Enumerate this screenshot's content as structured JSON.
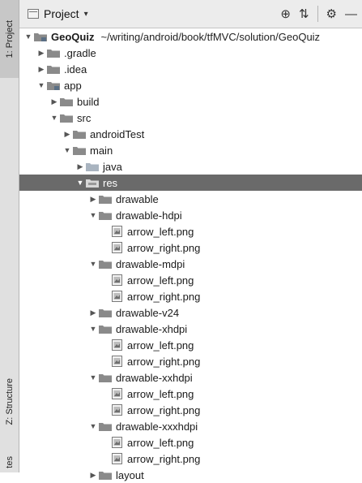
{
  "toolbar": {
    "title": "Project",
    "caret": "▾",
    "target": "⊕",
    "collapse": "⇅",
    "gear": "⚙",
    "minimize": "—"
  },
  "side_tabs": {
    "project": "1: Project",
    "structure": "Z: Structure",
    "favorites": "tes"
  },
  "tree": [
    {
      "label": "GeoQuiz",
      "path": "~/writing/android/book/tfMVC/solution/GeoQuiz",
      "depth": 0,
      "arrow": "▼",
      "icon": "module-folder-icon"
    },
    {
      "label": ".gradle",
      "depth": 1,
      "arrow": "▶",
      "icon": "folder-icon"
    },
    {
      "label": ".idea",
      "depth": 1,
      "arrow": "▶",
      "icon": "folder-icon"
    },
    {
      "label": "app",
      "depth": 1,
      "arrow": "▼",
      "icon": "module-folder-icon"
    },
    {
      "label": "build",
      "depth": 2,
      "arrow": "▶",
      "icon": "folder-icon"
    },
    {
      "label": "src",
      "depth": 2,
      "arrow": "▼",
      "icon": "folder-icon"
    },
    {
      "label": "androidTest",
      "depth": 3,
      "arrow": "▶",
      "icon": "folder-icon"
    },
    {
      "label": "main",
      "depth": 3,
      "arrow": "▼",
      "icon": "folder-icon"
    },
    {
      "label": "java",
      "depth": 4,
      "arrow": "▶",
      "icon": "source-folder-icon"
    },
    {
      "label": "res",
      "depth": 4,
      "arrow": "▼",
      "icon": "resource-folder-icon",
      "selected": true
    },
    {
      "label": "drawable",
      "depth": 5,
      "arrow": "▶",
      "icon": "folder-icon"
    },
    {
      "label": "drawable-hdpi",
      "depth": 5,
      "arrow": "▼",
      "icon": "folder-icon"
    },
    {
      "label": "arrow_left.png",
      "depth": 6,
      "arrow": "",
      "icon": "image-file-icon"
    },
    {
      "label": "arrow_right.png",
      "depth": 6,
      "arrow": "",
      "icon": "image-file-icon"
    },
    {
      "label": "drawable-mdpi",
      "depth": 5,
      "arrow": "▼",
      "icon": "folder-icon"
    },
    {
      "label": "arrow_left.png",
      "depth": 6,
      "arrow": "",
      "icon": "image-file-icon"
    },
    {
      "label": "arrow_right.png",
      "depth": 6,
      "arrow": "",
      "icon": "image-file-icon"
    },
    {
      "label": "drawable-v24",
      "depth": 5,
      "arrow": "▶",
      "icon": "folder-icon"
    },
    {
      "label": "drawable-xhdpi",
      "depth": 5,
      "arrow": "▼",
      "icon": "folder-icon"
    },
    {
      "label": "arrow_left.png",
      "depth": 6,
      "arrow": "",
      "icon": "image-file-icon"
    },
    {
      "label": "arrow_right.png",
      "depth": 6,
      "arrow": "",
      "icon": "image-file-icon"
    },
    {
      "label": "drawable-xxhdpi",
      "depth": 5,
      "arrow": "▼",
      "icon": "folder-icon"
    },
    {
      "label": "arrow_left.png",
      "depth": 6,
      "arrow": "",
      "icon": "image-file-icon"
    },
    {
      "label": "arrow_right.png",
      "depth": 6,
      "arrow": "",
      "icon": "image-file-icon"
    },
    {
      "label": "drawable-xxxhdpi",
      "depth": 5,
      "arrow": "▼",
      "icon": "folder-icon"
    },
    {
      "label": "arrow_left.png",
      "depth": 6,
      "arrow": "",
      "icon": "image-file-icon"
    },
    {
      "label": "arrow_right.png",
      "depth": 6,
      "arrow": "",
      "icon": "image-file-icon"
    },
    {
      "label": "layout",
      "depth": 5,
      "arrow": "▶",
      "icon": "folder-icon"
    }
  ],
  "colors": {
    "selected_bg": "#6a6a6a",
    "folder": "#8a8a8a",
    "toolbar_bg": "#ececec",
    "sidebar_bg": "#e0e0e0"
  }
}
